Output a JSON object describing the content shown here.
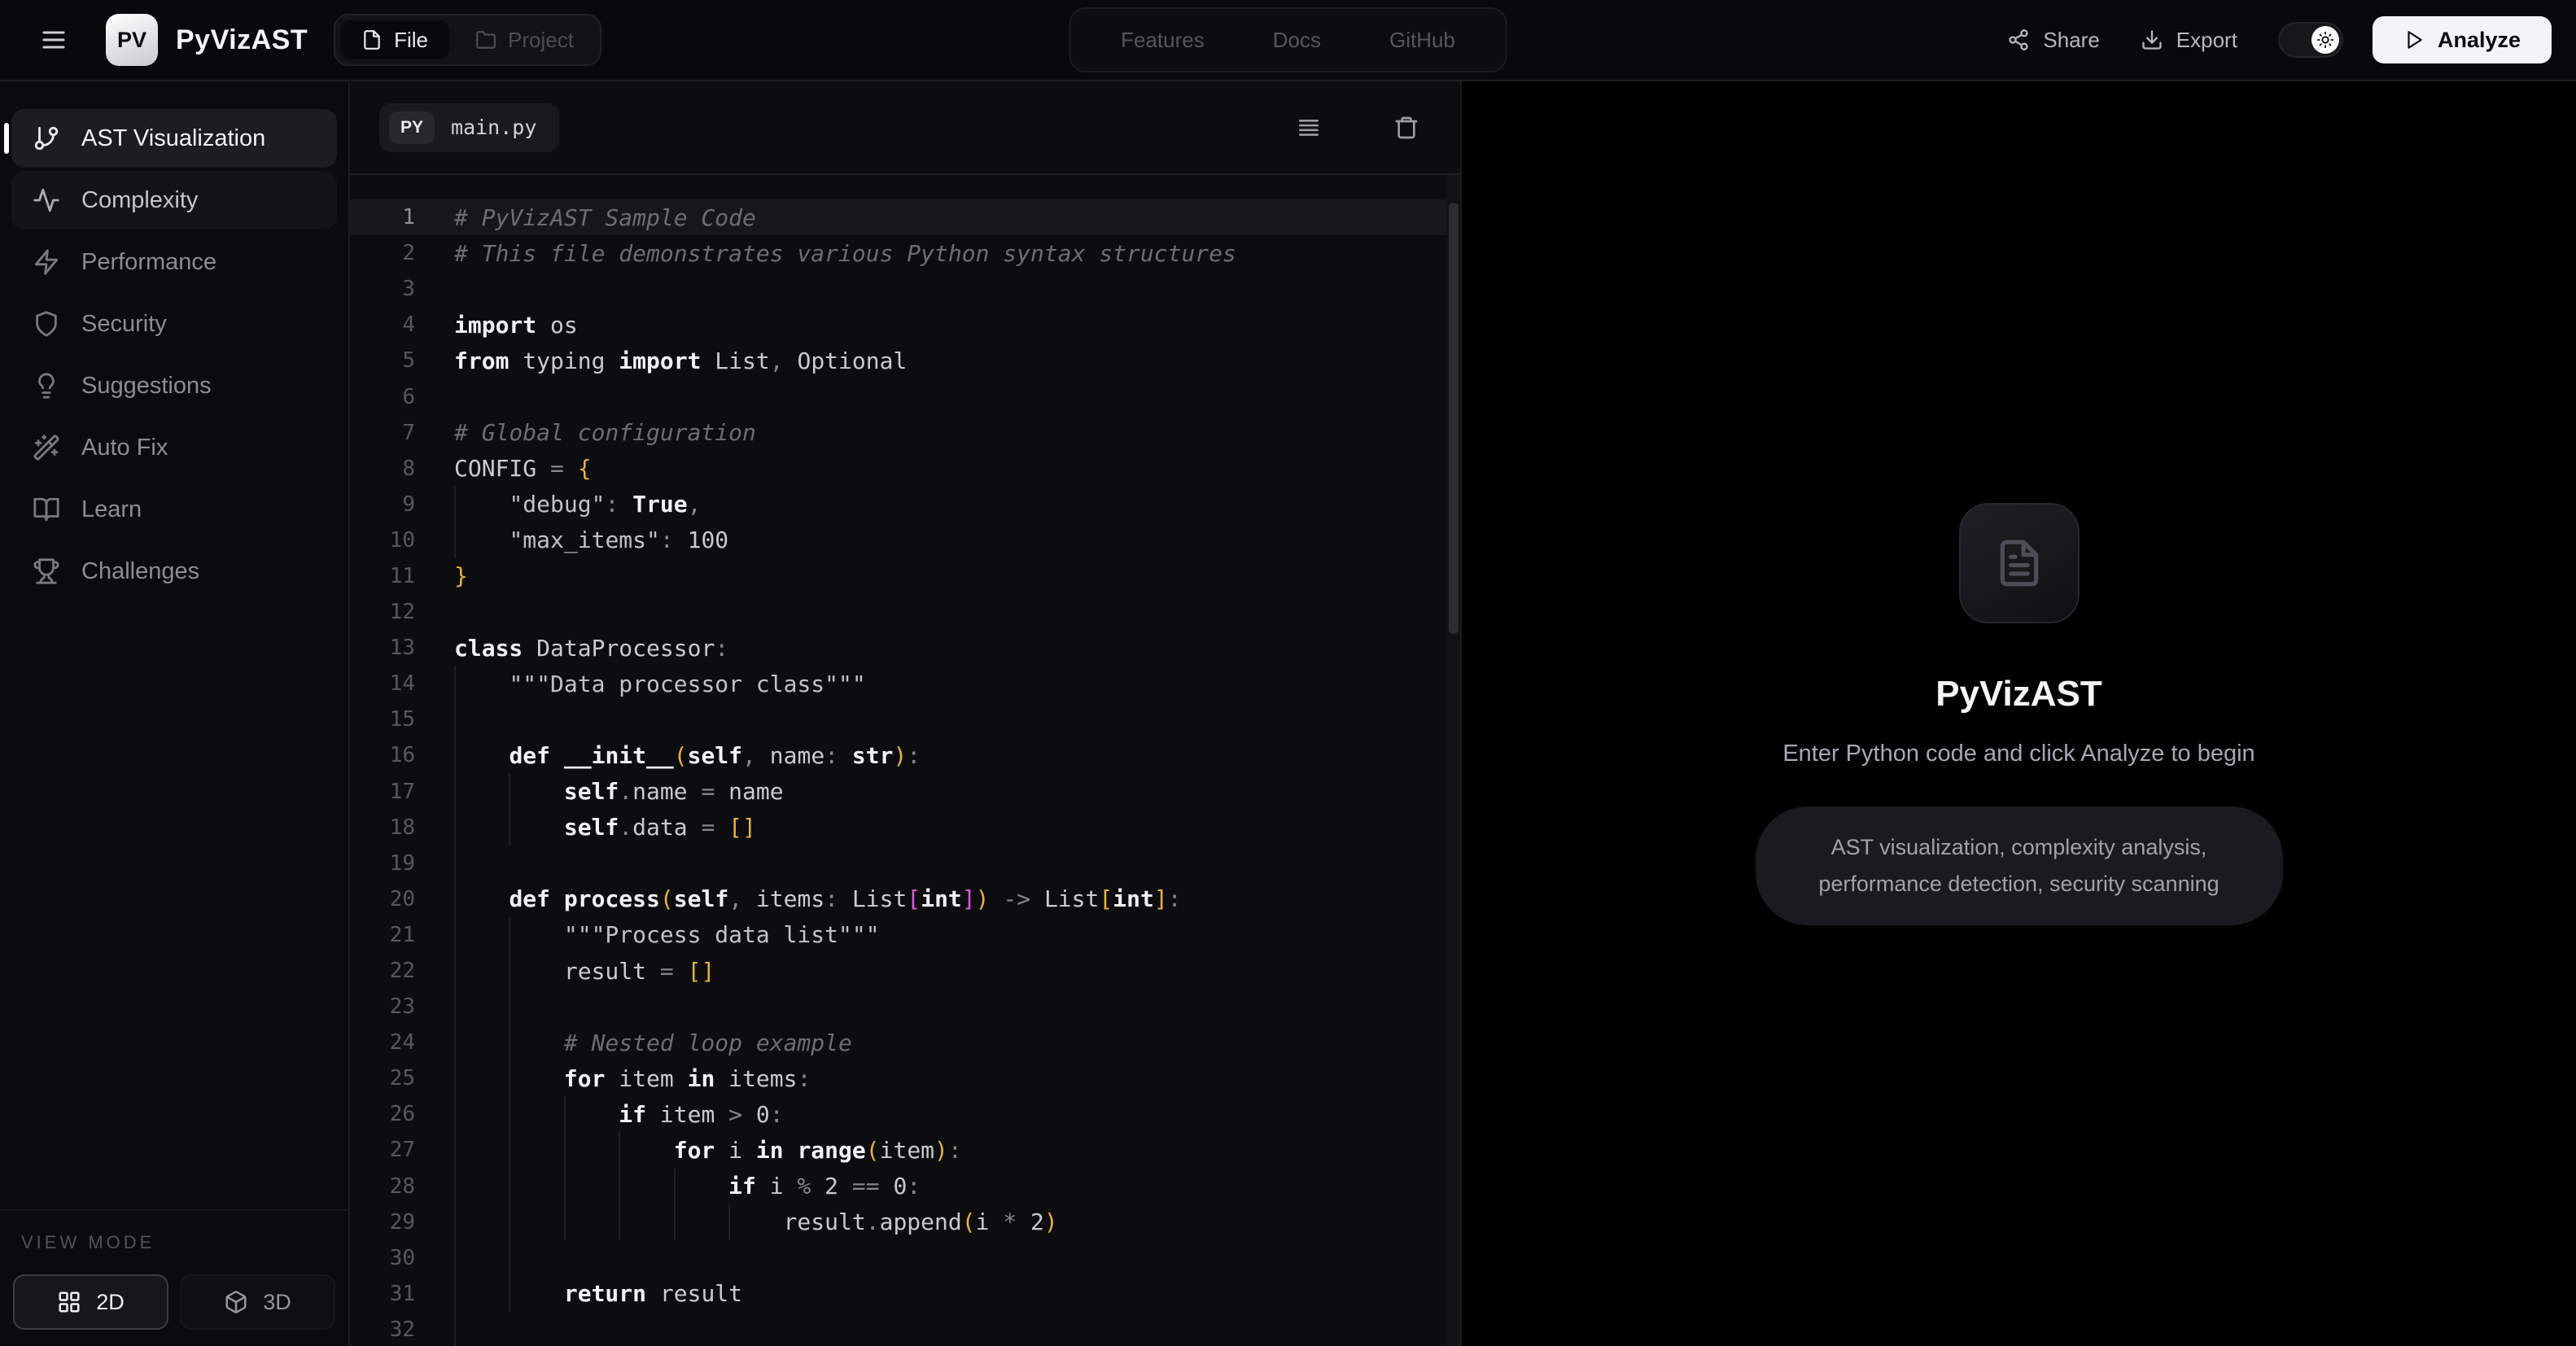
{
  "colors": {
    "bg": "#000000",
    "panel": "#0b0b0d",
    "editor-bg": "#0d0d0f",
    "line-highlight": "#17171a",
    "border": "#1d1d20",
    "text-bright": "#f2f2f4",
    "text-mid": "#9a9ca3",
    "text-dim": "#56585d",
    "comment": "#6b6d72",
    "code-plain": "#c9cbd0",
    "code-op": "#85878d",
    "string": "#bfc3c9",
    "bracket-1": "#e3b341",
    "bracket-2": "#d65cd6"
  },
  "header": {
    "logo_text": "PV",
    "app_title": "PyVizAST",
    "source_tabs": {
      "file": "File",
      "project": "Project"
    },
    "nav": [
      "Features",
      "Docs",
      "GitHub"
    ],
    "share_label": "Share",
    "export_label": "Export",
    "analyze_label": "Analyze"
  },
  "sidebar": {
    "items": [
      {
        "label": "AST Visualization",
        "icon": "git-branch",
        "state": "active"
      },
      {
        "label": "Complexity",
        "icon": "activity",
        "state": "highlight"
      },
      {
        "label": "Performance",
        "icon": "zap",
        "state": ""
      },
      {
        "label": "Security",
        "icon": "shield",
        "state": ""
      },
      {
        "label": "Suggestions",
        "icon": "lightbulb",
        "state": ""
      },
      {
        "label": "Auto Fix",
        "icon": "wand",
        "state": ""
      },
      {
        "label": "Learn",
        "icon": "book-open",
        "state": ""
      },
      {
        "label": "Challenges",
        "icon": "trophy",
        "state": ""
      }
    ],
    "view_mode_label": "VIEW MODE",
    "view_modes": [
      {
        "label": "2D",
        "icon": "grid",
        "active": true
      },
      {
        "label": "3D",
        "icon": "box",
        "active": false
      }
    ]
  },
  "editor": {
    "tab": {
      "badge": "PY",
      "filename": "main.py"
    },
    "lines": [
      {
        "n": 1,
        "cur": true,
        "g": 0,
        "t": [
          [
            "c",
            "# PyVizAST Sample Code"
          ]
        ]
      },
      {
        "n": 2,
        "g": 0,
        "t": [
          [
            "c",
            "# This file demonstrates various Python syntax structures"
          ]
        ]
      },
      {
        "n": 3,
        "g": 0,
        "t": []
      },
      {
        "n": 4,
        "g": 0,
        "t": [
          [
            "k",
            "import"
          ],
          [
            "p",
            " os"
          ]
        ]
      },
      {
        "n": 5,
        "g": 0,
        "t": [
          [
            "k",
            "from"
          ],
          [
            "p",
            " typing "
          ],
          [
            "k",
            "import"
          ],
          [
            "p",
            " List"
          ],
          [
            "o",
            ","
          ],
          [
            "p",
            " Optional"
          ]
        ]
      },
      {
        "n": 6,
        "g": 0,
        "t": []
      },
      {
        "n": 7,
        "g": 0,
        "t": [
          [
            "c",
            "# Global configuration"
          ]
        ]
      },
      {
        "n": 8,
        "g": 0,
        "t": [
          [
            "p",
            "CONFIG "
          ],
          [
            "o",
            "="
          ],
          [
            "p",
            " "
          ],
          [
            "b1",
            "{"
          ]
        ]
      },
      {
        "n": 9,
        "g": 1,
        "t": [
          [
            "p",
            "    "
          ],
          [
            "s",
            "\"debug\""
          ],
          [
            "o",
            ":"
          ],
          [
            "p",
            " "
          ],
          [
            "k",
            "True"
          ],
          [
            "o",
            ","
          ]
        ]
      },
      {
        "n": 10,
        "g": 1,
        "t": [
          [
            "p",
            "    "
          ],
          [
            "s",
            "\"max_items\""
          ],
          [
            "o",
            ":"
          ],
          [
            "p",
            " "
          ],
          [
            "n",
            "100"
          ]
        ]
      },
      {
        "n": 11,
        "g": 0,
        "t": [
          [
            "b1",
            "}"
          ]
        ]
      },
      {
        "n": 12,
        "g": 0,
        "t": []
      },
      {
        "n": 13,
        "g": 0,
        "t": [
          [
            "k",
            "class"
          ],
          [
            "p",
            " DataProcessor"
          ],
          [
            "o",
            ":"
          ]
        ]
      },
      {
        "n": 14,
        "g": 1,
        "t": [
          [
            "p",
            "    "
          ],
          [
            "s",
            "\"\"\"Data processor class\"\"\""
          ]
        ]
      },
      {
        "n": 15,
        "g": 1,
        "t": []
      },
      {
        "n": 16,
        "g": 1,
        "t": [
          [
            "p",
            "    "
          ],
          [
            "k",
            "def"
          ],
          [
            "p",
            " "
          ],
          [
            "f",
            "__init__"
          ],
          [
            "b1",
            "("
          ],
          [
            "k",
            "self"
          ],
          [
            "o",
            ","
          ],
          [
            "p",
            " name"
          ],
          [
            "o",
            ":"
          ],
          [
            "p",
            " "
          ],
          [
            "k",
            "str"
          ],
          [
            "b1",
            ")"
          ],
          [
            "o",
            ":"
          ]
        ]
      },
      {
        "n": 17,
        "g": 2,
        "t": [
          [
            "p",
            "        "
          ],
          [
            "k",
            "self"
          ],
          [
            "o",
            "."
          ],
          [
            "p",
            "name "
          ],
          [
            "o",
            "="
          ],
          [
            "p",
            " name"
          ]
        ]
      },
      {
        "n": 18,
        "g": 2,
        "t": [
          [
            "p",
            "        "
          ],
          [
            "k",
            "self"
          ],
          [
            "o",
            "."
          ],
          [
            "p",
            "data "
          ],
          [
            "o",
            "="
          ],
          [
            "p",
            " "
          ],
          [
            "b1",
            "[]"
          ]
        ]
      },
      {
        "n": 19,
        "g": 1,
        "t": []
      },
      {
        "n": 20,
        "g": 1,
        "t": [
          [
            "p",
            "    "
          ],
          [
            "k",
            "def"
          ],
          [
            "p",
            " "
          ],
          [
            "f",
            "process"
          ],
          [
            "b1",
            "("
          ],
          [
            "k",
            "self"
          ],
          [
            "o",
            ","
          ],
          [
            "p",
            " items"
          ],
          [
            "o",
            ":"
          ],
          [
            "p",
            " List"
          ],
          [
            "b2",
            "["
          ],
          [
            "k",
            "int"
          ],
          [
            "b2",
            "]"
          ],
          [
            "b1",
            ")"
          ],
          [
            "p",
            " "
          ],
          [
            "o",
            "->"
          ],
          [
            "p",
            " List"
          ],
          [
            "b1",
            "["
          ],
          [
            "k",
            "int"
          ],
          [
            "b1",
            "]"
          ],
          [
            "o",
            ":"
          ]
        ]
      },
      {
        "n": 21,
        "g": 2,
        "t": [
          [
            "p",
            "        "
          ],
          [
            "s",
            "\"\"\"Process data list\"\"\""
          ]
        ]
      },
      {
        "n": 22,
        "g": 2,
        "t": [
          [
            "p",
            "        result "
          ],
          [
            "o",
            "="
          ],
          [
            "p",
            " "
          ],
          [
            "b1",
            "[]"
          ]
        ]
      },
      {
        "n": 23,
        "g": 2,
        "t": []
      },
      {
        "n": 24,
        "g": 2,
        "t": [
          [
            "p",
            "        "
          ],
          [
            "c",
            "# Nested loop example"
          ]
        ]
      },
      {
        "n": 25,
        "g": 2,
        "t": [
          [
            "p",
            "        "
          ],
          [
            "k",
            "for"
          ],
          [
            "p",
            " item "
          ],
          [
            "k",
            "in"
          ],
          [
            "p",
            " items"
          ],
          [
            "o",
            ":"
          ]
        ]
      },
      {
        "n": 26,
        "g": 3,
        "t": [
          [
            "p",
            "            "
          ],
          [
            "k",
            "if"
          ],
          [
            "p",
            " item "
          ],
          [
            "o",
            ">"
          ],
          [
            "p",
            " "
          ],
          [
            "n",
            "0"
          ],
          [
            "o",
            ":"
          ]
        ]
      },
      {
        "n": 27,
        "g": 4,
        "t": [
          [
            "p",
            "                "
          ],
          [
            "k",
            "for"
          ],
          [
            "p",
            " i "
          ],
          [
            "k",
            "in"
          ],
          [
            "p",
            " "
          ],
          [
            "k",
            "range"
          ],
          [
            "b1",
            "("
          ],
          [
            "p",
            "item"
          ],
          [
            "b1",
            ")"
          ],
          [
            "o",
            ":"
          ]
        ]
      },
      {
        "n": 28,
        "g": 5,
        "t": [
          [
            "p",
            "                    "
          ],
          [
            "k",
            "if"
          ],
          [
            "p",
            " i "
          ],
          [
            "o",
            "%"
          ],
          [
            "p",
            " "
          ],
          [
            "n",
            "2"
          ],
          [
            "p",
            " "
          ],
          [
            "o",
            "=="
          ],
          [
            "p",
            " "
          ],
          [
            "n",
            "0"
          ],
          [
            "o",
            ":"
          ]
        ]
      },
      {
        "n": 29,
        "g": 6,
        "t": [
          [
            "p",
            "                        result"
          ],
          [
            "o",
            "."
          ],
          [
            "p",
            "append"
          ],
          [
            "b1",
            "("
          ],
          [
            "p",
            "i "
          ],
          [
            "o",
            "*"
          ],
          [
            "p",
            " "
          ],
          [
            "n",
            "2"
          ],
          [
            "b1",
            ")"
          ]
        ]
      },
      {
        "n": 30,
        "g": 2,
        "t": []
      },
      {
        "n": 31,
        "g": 2,
        "t": [
          [
            "p",
            "        "
          ],
          [
            "k",
            "return"
          ],
          [
            "p",
            " result"
          ]
        ]
      },
      {
        "n": 32,
        "g": 1,
        "t": []
      }
    ]
  },
  "empty_state": {
    "title": "PyVizAST",
    "subtitle": "Enter Python code and click Analyze to begin",
    "features_pill": "AST visualization, complexity analysis, performance detection, security scanning"
  }
}
